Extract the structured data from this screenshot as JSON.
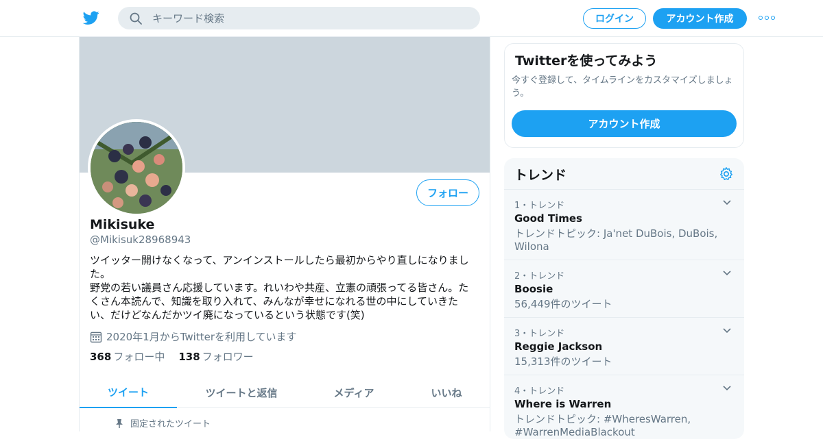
{
  "header": {
    "search_placeholder": "キーワード検索",
    "login_label": "ログイン",
    "signup_label": "アカウント作成"
  },
  "colors": {
    "accent": "#1da1f2",
    "banner": "#ccd6dd",
    "muted": "#657786"
  },
  "profile": {
    "follow_label": "フォロー",
    "name": "Mikisuke",
    "handle": "@Mikisuk28968943",
    "bio": "ツイッター開けなくなって、アンインストールしたら最初からやり直しになりました。\n野党の若い議員さん応援しています。れいわや共産、立憲の頑張ってる皆さん。たくさん本読んで、知識を取り入れて、みんなが幸せになれる世の中にしていきたい、だけどなんだかツイ廃になっているという状態です(笑)",
    "joined": "2020年1月からTwitterを利用しています",
    "following_count": "368",
    "following_label": "フォロー中",
    "followers_count": "138",
    "followers_label": "フォロワー",
    "tabs": [
      "ツイート",
      "ツイートと返信",
      "メディア",
      "いいね"
    ],
    "pinned_label": "固定されたツイート"
  },
  "signup_card": {
    "title": "Twitterを使ってみよう",
    "description": "今すぐ登録して、タイムラインをカスタマイズしましょう。",
    "button_label": "アカウント作成"
  },
  "trends": {
    "title": "トレンド",
    "items": [
      {
        "meta": "1・トレンド",
        "name": "Good Times",
        "sub": "トレンドトピック: Ja'net DuBois, DuBois, Wilona"
      },
      {
        "meta": "2・トレンド",
        "name": "Boosie",
        "sub": "56,449件のツイート"
      },
      {
        "meta": "3・トレンド",
        "name": "Reggie Jackson",
        "sub": "15,313件のツイート"
      },
      {
        "meta": "4・トレンド",
        "name": "Where is Warren",
        "sub": "トレンドトピック: #WheresWarren, #WarrenMediaBlackout"
      }
    ]
  }
}
